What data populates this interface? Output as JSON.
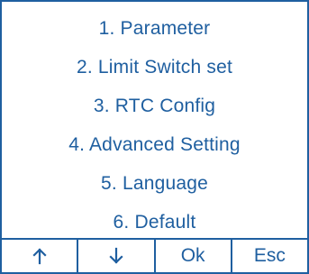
{
  "menu": {
    "items": [
      {
        "label": "1. Parameter"
      },
      {
        "label": "2. Limit Switch set"
      },
      {
        "label": "3. RTC Config"
      },
      {
        "label": "4. Advanced Setting"
      },
      {
        "label": "5. Language"
      },
      {
        "label": "6. Default"
      }
    ]
  },
  "softkeys": {
    "up_icon": "arrow-up-icon",
    "down_icon": "arrow-down-icon",
    "ok_label": "Ok",
    "esc_label": "Esc"
  },
  "colors": {
    "foreground": "#1f5fa0",
    "background": "#ffffff"
  }
}
